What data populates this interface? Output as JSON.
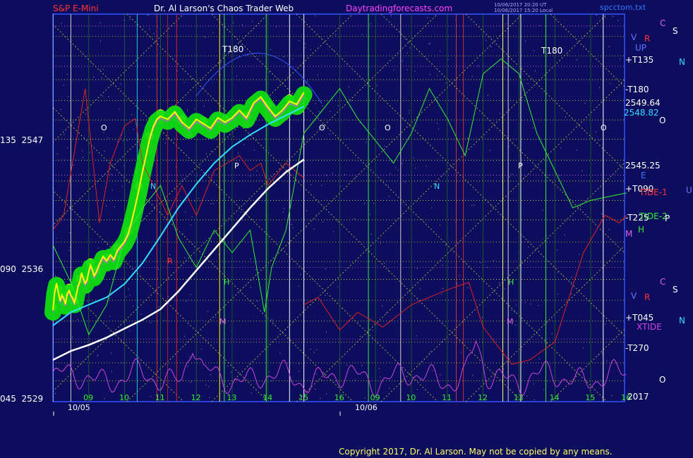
{
  "header": {
    "left_title": "S&P E-Mini",
    "center_title": "Dr. Al Larson's Chaos Trader Web",
    "site": "Daytradingforecasts.com",
    "file": "spcctom.txt",
    "timestamp1": "10/06/2017 20:20 UT",
    "timestamp2": "10/06/2017 15:20 Local"
  },
  "footer": {
    "copyright": "Copyright 2017, Dr. Al Larson. May not be copied by any means."
  },
  "colors": {
    "background": "#0d0d5e",
    "plot_border": "#3355ff",
    "price": "#ffff00",
    "halo": "#11dd11",
    "cyan_ma": "#33ddff",
    "white_ma": "#ffffff",
    "xtide": "#cc44dd",
    "red_line": "#dd2222",
    "green_line": "#33ee33",
    "lattice": "#dddd33"
  },
  "chart_data": {
    "type": "line",
    "title": "S&P E-Mini",
    "y_axis_left": [
      {
        "time_angle": "135",
        "price": "2547",
        "value": 2547
      },
      {
        "time_angle": "090",
        "price": "2536",
        "value": 2536
      },
      {
        "time_angle": "045",
        "price": "2529",
        "value": 2529
      }
    ],
    "ylim": [
      2529,
      2555
    ],
    "x_ticks_day1": [
      "09",
      "10",
      "11",
      "12",
      "13",
      "14",
      "15",
      "16"
    ],
    "x_ticks_day2": [
      "09",
      "10",
      "11",
      "12",
      "13",
      "14",
      "15",
      "16"
    ],
    "x_dates": [
      "10/05",
      "10/06"
    ],
    "year_label": "2017",
    "right_price_labels": [
      {
        "text": "2549.64",
        "value": 2549.64,
        "color": "#ffffff"
      },
      {
        "text": "2548.82",
        "value": 2548.82,
        "color": "#33ddff"
      },
      {
        "text": "2545.25",
        "value": 2545.25,
        "color": "#ffffff"
      }
    ],
    "right_time_labels": [
      {
        "text": "+T135",
        "color": "#ffffff"
      },
      {
        "text": "-T180",
        "color": "#ffffff"
      },
      {
        "text": "+T090",
        "color": "#ffffff"
      },
      {
        "text": "-T225",
        "color": "#ffffff"
      },
      {
        "text": "+T045",
        "color": "#ffffff"
      },
      {
        "text": "-T270",
        "color": "#ffffff"
      }
    ],
    "tide_labels": [
      {
        "text": "TIDE-1",
        "color": "#ff3333"
      },
      {
        "text": "TIDE-2",
        "color": "#33ee33"
      },
      {
        "text": "XTIDE",
        "color": "#cc44dd"
      }
    ],
    "planet_letters": [
      {
        "text": "C",
        "color": "#dd66dd"
      },
      {
        "text": "S",
        "color": "#ffffff"
      },
      {
        "text": "V",
        "color": "#6677ff"
      },
      {
        "text": "R",
        "color": "#ff3333"
      },
      {
        "text": "UP",
        "color": "#6677ff"
      },
      {
        "text": "N",
        "color": "#33ddff"
      },
      {
        "text": "O",
        "color": "#ffffff"
      },
      {
        "text": "E",
        "color": "#3377ff"
      },
      {
        "text": "U",
        "color": "#6677ff"
      },
      {
        "text": "P",
        "color": "#ffffff"
      },
      {
        "text": "H",
        "color": "#33ee33"
      },
      {
        "text": "M",
        "color": "#dd66dd"
      },
      {
        "text": "C",
        "color": "#dd66dd"
      },
      {
        "text": "S",
        "color": "#ffffff"
      },
      {
        "text": "V",
        "color": "#6677ff"
      },
      {
        "text": "R",
        "color": "#ff3333"
      },
      {
        "text": "N",
        "color": "#33ddff"
      },
      {
        "text": "O",
        "color": "#ffffff"
      }
    ],
    "t180_markers": [
      "T180",
      "T180"
    ],
    "flux_letters": [
      {
        "text": "O",
        "color": "#ffffff"
      },
      {
        "text": "P",
        "color": "#ffffff"
      },
      {
        "text": "N",
        "color": "#33ddff"
      },
      {
        "text": "H",
        "color": "#33ee33"
      },
      {
        "text": "M",
        "color": "#dd66dd"
      },
      {
        "text": "R",
        "color": "#ff3333"
      },
      {
        "text": "O",
        "color": "#ffffff"
      },
      {
        "text": "O",
        "color": "#ffffff"
      },
      {
        "text": "P",
        "color": "#ffffff"
      },
      {
        "text": "N",
        "color": "#33ddff"
      },
      {
        "text": "H",
        "color": "#33ee33"
      },
      {
        "text": "M",
        "color": "#dd66dd"
      },
      {
        "text": "O",
        "color": "#ffffff"
      }
    ],
    "series": [
      {
        "color": "#ffff00",
        "x": [
          0,
          0.05,
          0.1,
          0.15,
          0.2,
          0.25,
          0.3,
          0.35,
          0.4,
          0.45,
          0.5,
          0.55,
          0.6,
          0.65,
          0.7,
          0.75,
          0.8,
          0.85,
          0.9,
          0.95,
          1.0,
          1.05,
          1.1,
          1.15,
          1.2,
          1.3,
          1.4,
          1.5,
          1.6,
          1.7,
          1.8,
          1.9,
          2.0,
          2.1,
          2.2,
          2.3,
          2.4,
          2.5,
          2.6,
          2.7,
          2.8,
          2.9,
          3.0,
          3.2,
          3.4,
          3.6,
          3.8,
          4.0,
          4.2,
          4.4,
          4.6,
          4.8,
          5.0,
          5.2,
          5.4,
          5.6,
          5.8,
          6.0,
          6.2,
          6.4,
          6.6,
          6.8,
          7.0
        ],
        "y": [
          2535.0,
          2536.2,
          2536.8,
          2536.2,
          2535.6,
          2536.0,
          2535.8,
          2535.4,
          2536.1,
          2536.3,
          2536.0,
          2535.8,
          2535.5,
          2536.0,
          2536.6,
          2536.9,
          2537.5,
          2537.1,
          2536.8,
          2537.0,
          2537.6,
          2538.0,
          2537.7,
          2537.3,
          2537.5,
          2538.1,
          2538.6,
          2538.3,
          2538.7,
          2538.4,
          2539.0,
          2539.3,
          2539.6,
          2540.1,
          2541.0,
          2542.0,
          2543.1,
          2544.3,
          2545.4,
          2546.5,
          2547.3,
          2547.8,
          2548.0,
          2547.8,
          2548.3,
          2547.6,
          2547.2,
          2547.8,
          2547.5,
          2547.2,
          2547.9,
          2547.6,
          2547.9,
          2548.4,
          2547.9,
          2548.9,
          2549.3,
          2548.6,
          2548.0,
          2548.4,
          2549.0,
          2548.8,
          2549.6
        ]
      },
      {
        "color": "#33ddff",
        "x": [
          0,
          0.5,
          1.0,
          1.5,
          2.0,
          2.5,
          3.0,
          3.5,
          4.0,
          4.5,
          5.0,
          5.5,
          6.0,
          6.5,
          7.0
        ],
        "y": [
          2534.1,
          2535.0,
          2535.5,
          2536.0,
          2536.9,
          2538.3,
          2540.1,
          2542.0,
          2543.6,
          2545.0,
          2546.1,
          2546.9,
          2547.6,
          2548.2,
          2548.8
        ]
      },
      {
        "color": "#ffffff",
        "x": [
          0,
          0.5,
          1.0,
          1.5,
          2.0,
          2.5,
          3.0,
          3.5,
          4.0,
          4.5,
          5.0,
          5.5,
          6.0,
          6.5,
          7.0
        ],
        "y": [
          2531.8,
          2532.4,
          2532.8,
          2533.3,
          2533.9,
          2534.5,
          2535.2,
          2536.4,
          2537.8,
          2539.2,
          2540.6,
          2542.0,
          2543.3,
          2544.4,
          2545.25
        ]
      }
    ]
  }
}
